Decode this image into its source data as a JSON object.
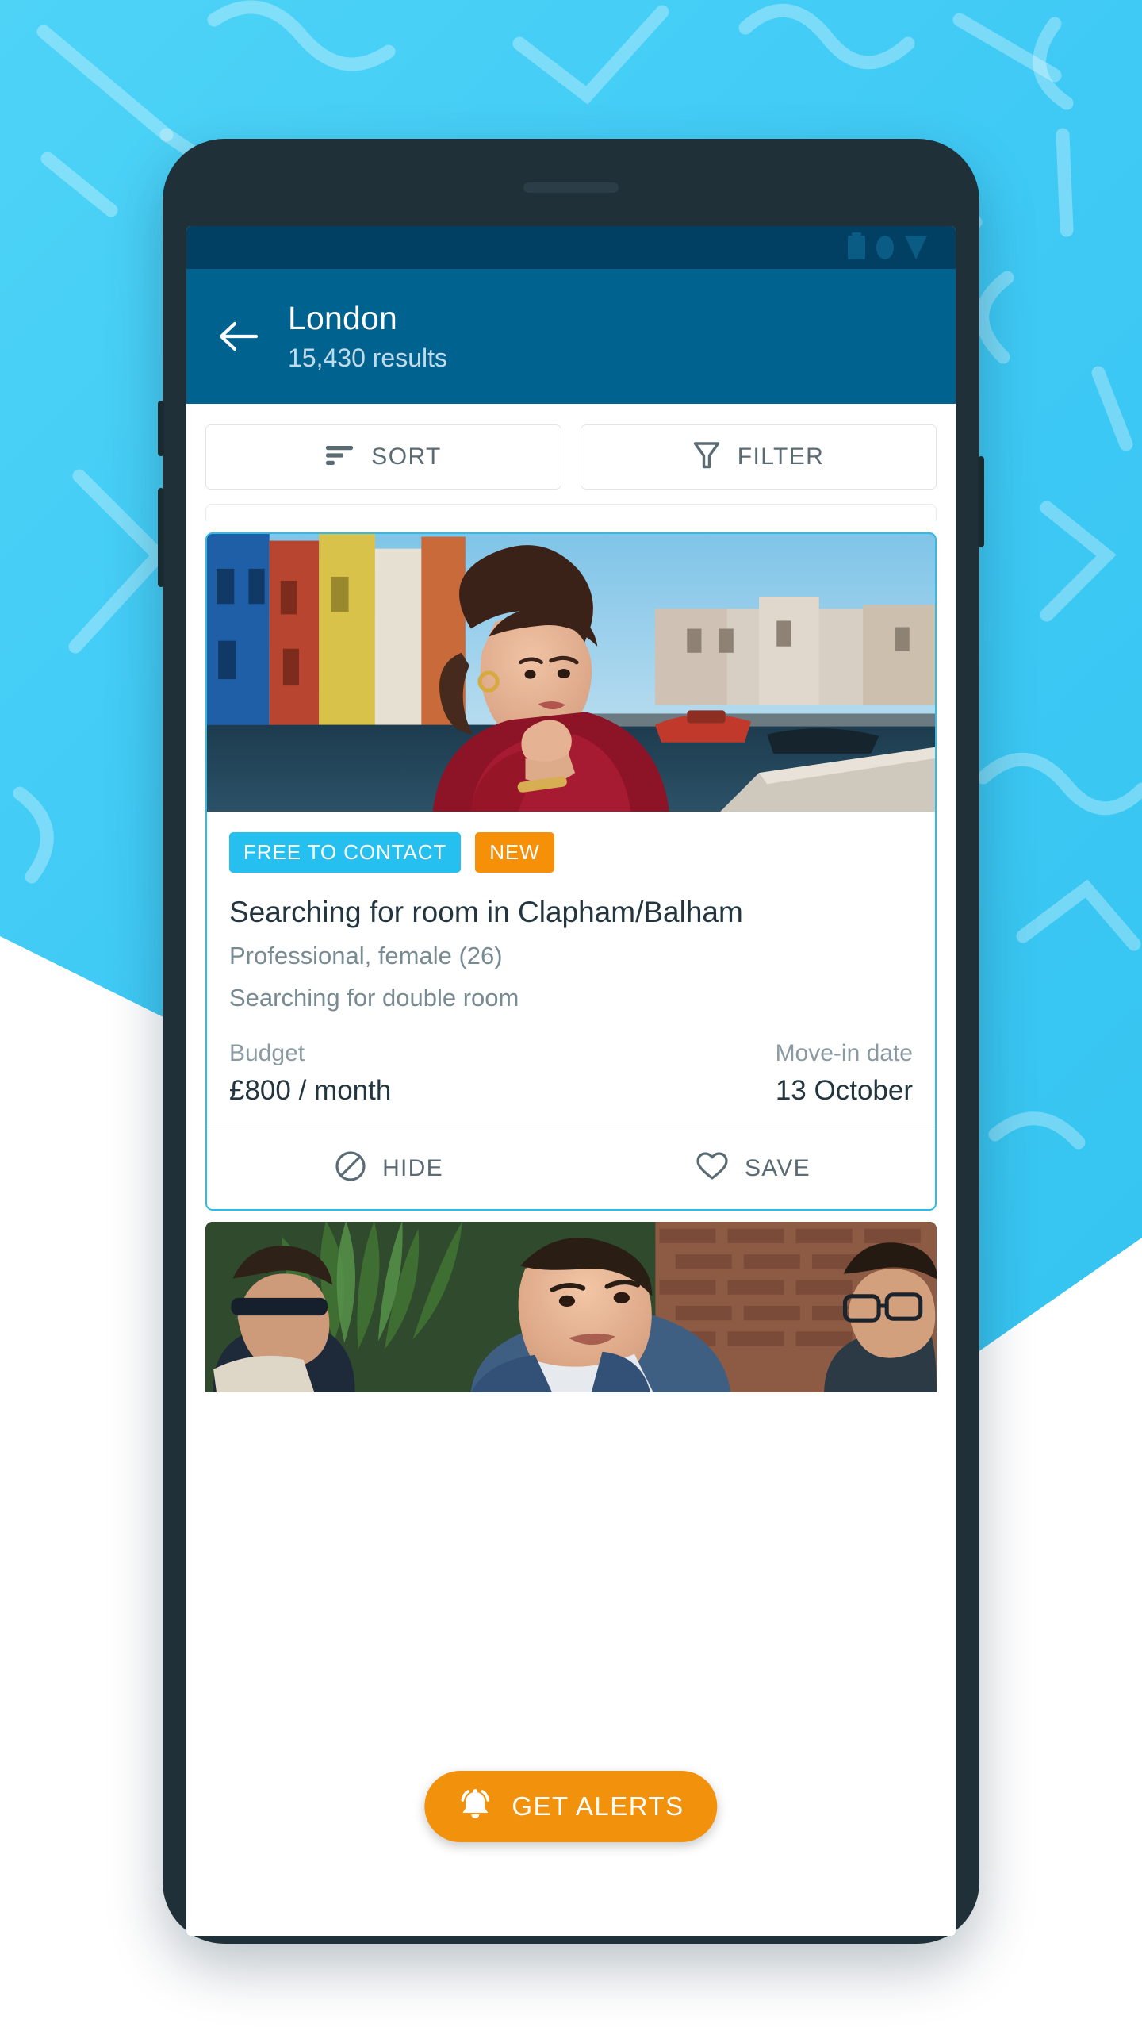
{
  "statusbar": {
    "icons": [
      "battery-icon",
      "circle-icon",
      "dropdown-triangle-icon"
    ]
  },
  "appbar": {
    "back_icon": "back-arrow-icon",
    "title": "London",
    "subtitle": "15,430 results",
    "bg_color": "#00628f"
  },
  "controls": {
    "sort": {
      "label": "SORT",
      "icon": "sort-lines-icon"
    },
    "filter": {
      "label": "FILTER",
      "icon": "funnel-icon"
    }
  },
  "listing": {
    "badges": [
      {
        "label": "FREE TO CONTACT",
        "color": "#25c0ef"
      },
      {
        "label": "NEW",
        "color": "#f79009"
      }
    ],
    "title": "Searching for room in Clapham/Balham",
    "meta_line_1": "Professional, female (26)",
    "meta_line_2": "Searching for double room",
    "facts": [
      {
        "label": "Budget",
        "value": "£800 / month"
      },
      {
        "label": "Move-in date",
        "value": "13 October"
      }
    ],
    "actions": [
      {
        "label": "HIDE",
        "icon": "block-circle-icon"
      },
      {
        "label": "SAVE",
        "icon": "heart-icon"
      }
    ],
    "highlight_color": "#29bdeb"
  },
  "fab": {
    "label": "GET ALERTS",
    "icon": "bell-icon",
    "color": "#f2920c"
  },
  "theme": {
    "backdrop_color": "#43cef5",
    "phone_body_color": "#1f3038",
    "statusbar_color": "#014063"
  }
}
